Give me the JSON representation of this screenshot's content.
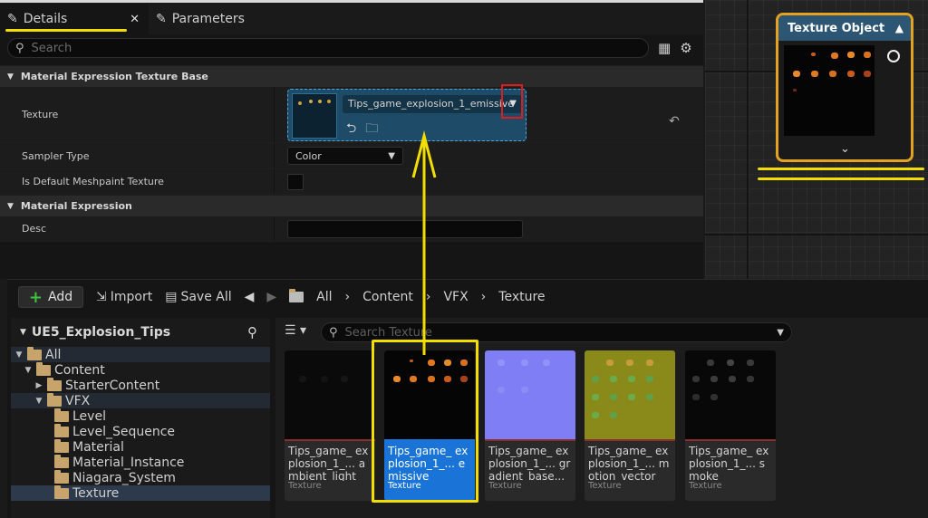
{
  "details": {
    "tabs": [
      {
        "label": "Details",
        "close": "✕"
      },
      {
        "label": "Parameters"
      }
    ],
    "search_placeholder": "Search",
    "sections": {
      "texture_base": "Material Expression Texture Base",
      "expression": "Material Expression"
    },
    "props": {
      "texture_label": "Texture",
      "texture_value": "Tips_game_explosion_1_emissive",
      "sampler_label": "Sampler Type",
      "sampler_value": "Color",
      "meshpaint_label": "Is Default Meshpaint Texture",
      "desc_label": "Desc"
    }
  },
  "node": {
    "title": "Texture Object"
  },
  "content_browser": {
    "add_label": "Add",
    "import_label": "Import",
    "saveall_label": "Save All",
    "breadcrumbs": [
      "All",
      "Content",
      "VFX",
      "Texture"
    ],
    "tree_title": "UE5_Explosion_Tips",
    "tree": [
      {
        "label": "All",
        "depth": 0
      },
      {
        "label": "Content",
        "depth": 1
      },
      {
        "label": "StarterContent",
        "depth": 2
      },
      {
        "label": "VFX",
        "depth": 2
      },
      {
        "label": "Level",
        "depth": 3
      },
      {
        "label": "Level_Sequence",
        "depth": 3
      },
      {
        "label": "Material",
        "depth": 3
      },
      {
        "label": "Material_Instance",
        "depth": 3
      },
      {
        "label": "Niagara_System",
        "depth": 3
      },
      {
        "label": "Texture",
        "depth": 3
      }
    ],
    "asset_search_placeholder": "Search Texture",
    "assets": [
      {
        "name": "Tips_game_ explosion_1_... ambient_light",
        "type": "Texture"
      },
      {
        "name": "Tips_game_ explosion_1_... emissive",
        "type": "Texture"
      },
      {
        "name": "Tips_game_ explosion_1_... gradient_base...",
        "type": "Texture"
      },
      {
        "name": "Tips_game_ explosion_1_... motion_vector",
        "type": "Texture"
      },
      {
        "name": "Tips_game_ explosion_1_... smoke",
        "type": "Texture"
      }
    ]
  },
  "colors": {
    "annotation_yellow": "#f2de00",
    "annotation_red": "#e01b1b",
    "selection_blue": "#1a74d8",
    "node_orange": "#e3a320"
  }
}
